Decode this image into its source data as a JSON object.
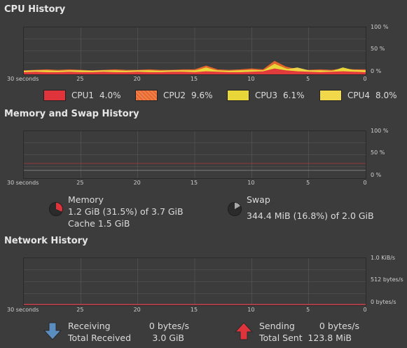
{
  "cpu": {
    "title": "CPU History",
    "x_ticks": [
      "30 seconds",
      "25",
      "20",
      "15",
      "10",
      "5",
      "0"
    ],
    "y_ticks": [
      "100 %",
      "50 %",
      "0 %"
    ],
    "legend": [
      {
        "name": "CPU1",
        "value": "4.0%",
        "color": "#e0343c"
      },
      {
        "name": "CPU2",
        "value": "9.6%",
        "color": "#e9672b"
      },
      {
        "name": "CPU3",
        "value": "6.1%",
        "color": "#e9d739"
      },
      {
        "name": "CPU4",
        "value": "8.0%",
        "color": "#f0d84a"
      }
    ]
  },
  "memory": {
    "title": "Memory and Swap History",
    "x_ticks": [
      "30 seconds",
      "25",
      "20",
      "15",
      "10",
      "5",
      "0"
    ],
    "y_ticks": [
      "100 %",
      "50 %",
      "0 %"
    ],
    "memory_label": "Memory",
    "memory_used": "1.2 GiB (31.5%) of 3.7 GiB",
    "memory_cache": "Cache 1.5 GiB",
    "memory_fraction": 0.315,
    "memory_color": "#e0343c",
    "swap_label": "Swap",
    "swap_used": "344.4 MiB (16.8%) of 2.0 GiB",
    "swap_fraction": 0.168,
    "swap_color": "#a9a9a9"
  },
  "network": {
    "title": "Network History",
    "x_ticks": [
      "30 seconds",
      "25",
      "20",
      "15",
      "10",
      "5",
      "0"
    ],
    "y_ticks": [
      "1.0 KiB/s",
      "512 bytes/s",
      "0 bytes/s"
    ],
    "receiving_label": "Receiving",
    "receiving_value": "0 bytes/s",
    "total_received_label": "Total Received",
    "total_received_value": "3.0 GiB",
    "sending_label": "Sending",
    "sending_value": "0 bytes/s",
    "total_sent_label": "Total Sent",
    "total_sent_value": "123.8 MiB",
    "receive_color": "#5b8ec0",
    "send_color": "#e0343c"
  },
  "chart_data": [
    {
      "type": "area",
      "title": "CPU History",
      "xlim": [
        30,
        0
      ],
      "ylim": [
        0,
        100
      ],
      "x": [
        30,
        29,
        28,
        27,
        26,
        25,
        24,
        23,
        22,
        21,
        20,
        19,
        18,
        17,
        16,
        15,
        14,
        13,
        12,
        11,
        10,
        9,
        8,
        7,
        6,
        5,
        4,
        3,
        2,
        1,
        0
      ],
      "series": [
        {
          "name": "CPU1",
          "values": [
            4,
            5,
            4,
            4,
            5,
            4,
            4,
            5,
            4,
            4,
            5,
            4,
            4,
            5,
            5,
            4,
            6,
            5,
            4,
            4,
            5,
            6,
            12,
            8,
            6,
            5,
            4,
            5,
            6,
            5,
            4
          ]
        },
        {
          "name": "CPU2",
          "values": [
            8,
            9,
            10,
            9,
            10,
            9,
            8,
            9,
            10,
            9,
            9,
            10,
            9,
            9,
            10,
            10,
            18,
            10,
            9,
            10,
            12,
            10,
            28,
            16,
            10,
            9,
            10,
            9,
            12,
            10,
            10
          ]
        },
        {
          "name": "CPU3",
          "values": [
            6,
            6,
            7,
            6,
            6,
            7,
            6,
            6,
            7,
            6,
            6,
            7,
            6,
            6,
            7,
            7,
            14,
            7,
            6,
            7,
            9,
            7,
            22,
            12,
            7,
            6,
            7,
            6,
            14,
            8,
            6
          ]
        },
        {
          "name": "CPU4",
          "values": [
            7,
            8,
            8,
            7,
            8,
            8,
            7,
            8,
            8,
            7,
            8,
            8,
            7,
            8,
            8,
            8,
            12,
            8,
            7,
            8,
            9,
            8,
            18,
            10,
            14,
            8,
            8,
            7,
            10,
            9,
            8
          ]
        }
      ]
    },
    {
      "type": "line",
      "title": "Memory and Swap History",
      "xlim": [
        30,
        0
      ],
      "ylim": [
        0,
        100
      ],
      "x": [
        30,
        0
      ],
      "series": [
        {
          "name": "Memory",
          "values": [
            31.5,
            31.5
          ]
        },
        {
          "name": "Swap",
          "values": [
            16.8,
            16.8
          ]
        }
      ]
    },
    {
      "type": "line",
      "title": "Network History",
      "xlim": [
        30,
        0
      ],
      "ylim": [
        0,
        1024
      ],
      "x": [
        30,
        0
      ],
      "series": [
        {
          "name": "Receiving",
          "values": [
            0,
            0
          ]
        },
        {
          "name": "Sending",
          "values": [
            0,
            0
          ]
        }
      ]
    }
  ]
}
